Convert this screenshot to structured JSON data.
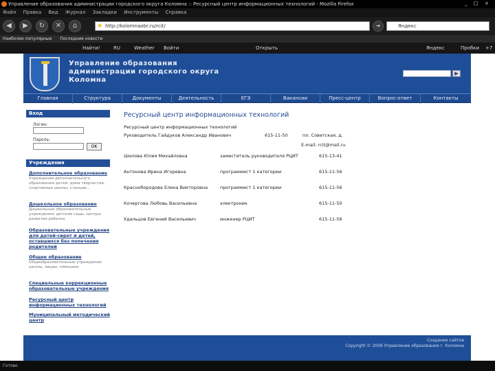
{
  "window": {
    "title": "Управление образования администрации городского округа Коломна :: Ресурсный центр информационных технологий - Mozilla Firefox",
    "controls": [
      "_",
      "□",
      "×"
    ]
  },
  "menubar": [
    "Файл",
    "Правка",
    "Вид",
    "Журнал",
    "Закладки",
    "Инструменты",
    "Справка"
  ],
  "nav": {
    "url": "http://kolomnaobr.ru/rcit/",
    "search_placeholder": "Яндекс"
  },
  "bookmarks": [
    "Наиболее популярные",
    "Последние новости"
  ],
  "toolbar2": {
    "left": [
      "Найти!",
      "RU",
      "Weather",
      "Войти"
    ],
    "right_label": "Открыть",
    "extras": [
      "Яндекс",
      "Пробки",
      "+7"
    ]
  },
  "site": {
    "title_lines": [
      "Управление образования",
      "администрации городского округа",
      "Коломна"
    ],
    "search_button": "▶",
    "nav": [
      "Главная",
      "Структура",
      "Документы",
      "Деятельность",
      "ЕГЭ",
      "Вакансии",
      "Пресс-центр",
      "Вопрос-ответ",
      "Контакты"
    ],
    "login": {
      "heading": "Вход",
      "login_label": "Логин:",
      "password_label": "Пароль:",
      "ok": "OK"
    },
    "institutions_heading": "Учреждения",
    "sidebar_links": [
      {
        "title": "Дополнительное образование",
        "desc": "Учреждения дополнительного образования детей: дома творчества, спортивные школы, станции..."
      },
      {
        "title": "Дошкольное образование",
        "desc": "Дошкольные образовательные учреждения: детские сады, центры развития ребенка"
      },
      {
        "title": "Образовательные учреждения для детей-сирот и детей, оставшихся без попечения родителей",
        "desc": ""
      },
      {
        "title": "Общее образование",
        "desc": "Общеобразовательные учреждения: школы, лицеи, гимназии"
      },
      {
        "title": "Специальные коррекционные образовательные учреждения",
        "desc": ""
      },
      {
        "title": "Ресурсный центр информационных технологий",
        "desc": ""
      },
      {
        "title": "Муниципальный методический центр",
        "desc": ""
      }
    ],
    "content": {
      "heading": "Ресурсный центр информационных технологий",
      "subheading": "Ресурсный центр информационных технологий",
      "director": "Руководитель Гайдуков Александр Иванович",
      "director_phone": "615-11-50",
      "director_address": "пл. Советская, д.",
      "email": "E-mail: rcit@mail.ru",
      "staff": [
        {
          "name": "Шилова Юлия Михайловна",
          "role": "заместитель руководителя РЦИТ",
          "phone": "615-13-41"
        },
        {
          "name": "Антонова Ирина Игоревна",
          "role": "программист 1 категории",
          "phone": "615-11-56"
        },
        {
          "name": "Краснобородова Елена Викторовна",
          "role": "программист 1 категории",
          "phone": "615-11-56"
        },
        {
          "name": "Кочергова Любовь Васильевна",
          "role": "электроник",
          "phone": "615-11-50"
        },
        {
          "name": "Удальцов Евгений Васильевич",
          "role": "инженер РЦИТ",
          "phone": "615-11-56"
        }
      ]
    },
    "footer": [
      "Создание сайтов",
      "Copyright © 2009 Управление образования г. Коломна"
    ]
  },
  "status": "Готово"
}
